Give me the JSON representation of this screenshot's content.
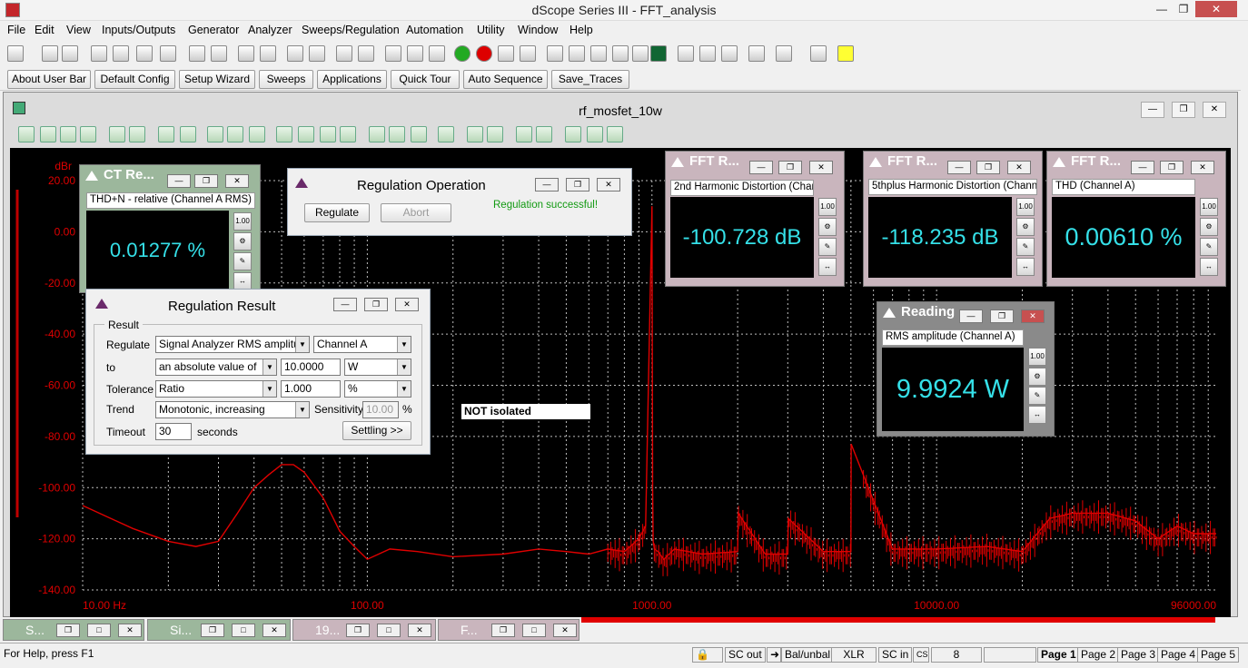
{
  "app": {
    "title": "dScope Series III - FFT_analysis"
  },
  "menu": [
    "File",
    "Edit",
    "View",
    "Inputs/Outputs",
    "Generator",
    "Analyzer",
    "Sweeps/Regulation",
    "Automation",
    "Utility",
    "Window",
    "Help"
  ],
  "user_bar": [
    "About User Bar",
    "Default Config",
    "Setup Wizard",
    "Sweeps",
    "Applications",
    "Quick Tour",
    "Auto Sequence",
    "Save_Traces"
  ],
  "document": {
    "title": "rf_mosfet_10w"
  },
  "ct_reading": {
    "title": "CT Re...",
    "label": "THD+N - relative (Channel A RMS)",
    "value": "0.01277 %"
  },
  "regulation_operation": {
    "title": "Regulation Operation",
    "regulate_label": "Regulate",
    "abort_label": "Abort",
    "status": "Regulation successful!"
  },
  "regulation_result": {
    "title": "Regulation Result",
    "group": "Result",
    "regulate_label": "Regulate",
    "regulate_value": "Signal Analyzer RMS amplitude",
    "channel_value": "Channel A",
    "to_label": "to",
    "to_mode": "an absolute value of",
    "to_value": "10.0000",
    "to_unit": "W",
    "tolerance_label": "Tolerance",
    "tolerance_mode": "Ratio",
    "tolerance_value": "1.000",
    "tolerance_unit": "%",
    "trend_label": "Trend",
    "trend_value": "Monotonic, increasing",
    "sensitivity_label": "Sensitivity",
    "sensitivity_value": "10.00",
    "sensitivity_unit": "%",
    "timeout_label": "Timeout",
    "timeout_value": "30",
    "timeout_unit": "seconds",
    "settling_label": "Settling >>"
  },
  "fft1": {
    "title": "FFT R...",
    "label": "2nd Harmonic Distortion (Channel A)",
    "value": "-100.728 dB"
  },
  "fft2": {
    "title": "FFT R...",
    "label": "5thplus Harmonic Distortion (Channel A)",
    "value": "-118.235 dB"
  },
  "fft3": {
    "title": "FFT R...",
    "label": "THD (Channel A)",
    "value": "0.00610 %"
  },
  "reading": {
    "title": "Reading",
    "label": "RMS amplitude (Channel A)",
    "value": "9.9924 W"
  },
  "annotation": "NOT isolated",
  "mini_windows": [
    "S...",
    "Si...",
    "19...",
    "F..."
  ],
  "status": {
    "help": "For Help, press F1",
    "sc_out": "SC out",
    "bal": "Bal/unbal",
    "xlr": "XLR",
    "sc_in": "SC in",
    "cs": "CS",
    "num": "8",
    "pages": [
      "Page 1",
      "Page 2",
      "Page 3",
      "Page 4",
      "Page 5"
    ]
  },
  "colors": {
    "trace": "#e00000",
    "meter_text": "#35e0e8",
    "plot_bg": "#000000"
  },
  "chart_data": {
    "type": "line",
    "ylabel": "dBr",
    "x_ticks": [
      "10.00 Hz",
      "100.00",
      "1000.00",
      "10000.00",
      "96000.00"
    ],
    "y_ticks": [
      "20.00",
      "0.00",
      "-20.00",
      "-40.00",
      "-60.00",
      "-80.00",
      "-100.00",
      "-120.00",
      "-140.00"
    ],
    "xlim": [
      10,
      96000
    ],
    "ylim": [
      -140,
      20
    ],
    "x_scale": "log",
    "grid": true,
    "series": [
      {
        "x": [
          10,
          15,
          20,
          25,
          30,
          35,
          40,
          45,
          50,
          55,
          60,
          70,
          80,
          90,
          100,
          120,
          150,
          200,
          300,
          400,
          500,
          600,
          700,
          800,
          900,
          950,
          1000,
          1005,
          1010,
          1020,
          1050,
          1100,
          1200,
          1500,
          2000,
          2010,
          2500,
          3000,
          3010,
          4000,
          5000,
          5010,
          7000,
          10000,
          15000,
          20000,
          25000,
          30000,
          40000,
          50000,
          60000,
          70000,
          80000,
          96000
        ],
        "values": [
          -107,
          -116,
          -121,
          -123,
          -121,
          -110,
          -100,
          -95,
          -91,
          -91,
          -94,
          -104,
          -117,
          -123,
          -128,
          -124,
          -125,
          -127,
          -126,
          -124,
          -125,
          -126,
          -124,
          -125,
          -120,
          -115,
          10,
          -100,
          -121,
          -124,
          -125,
          -128,
          -124,
          -126,
          -125,
          -110,
          -126,
          -126,
          -112,
          -125,
          -125,
          -83,
          -124,
          -124,
          -123,
          -125,
          -112,
          -110,
          -110,
          -113,
          -120,
          -115,
          -118,
          -118
        ]
      }
    ]
  }
}
